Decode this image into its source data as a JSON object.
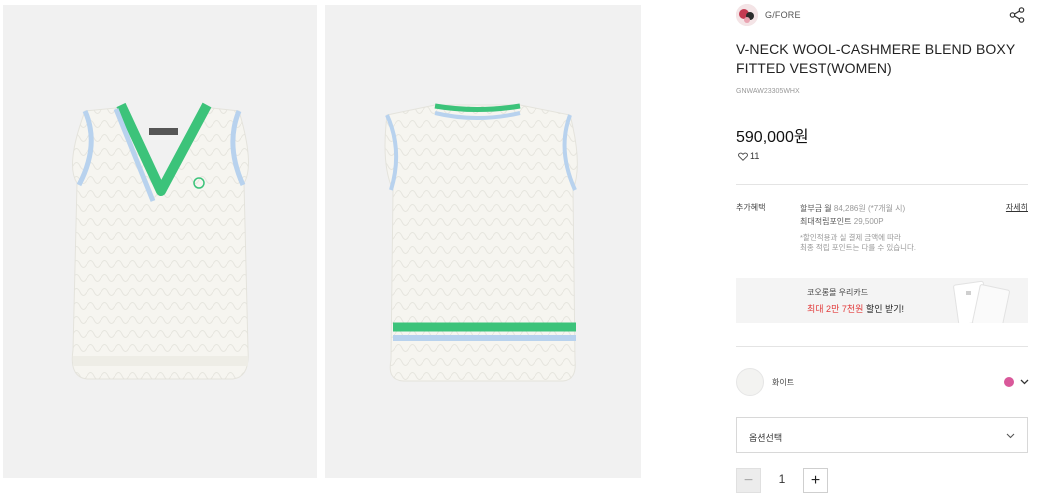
{
  "product": {
    "brand": "G/FORE",
    "title": "V-NECK WOOL-CASHMERE BLEND BOXY FITTED VEST(WOMEN)",
    "code": "GNWAW23305WHX",
    "price": "590,000원",
    "likes": "11"
  },
  "benefits": {
    "label": "추가혜택",
    "installment_prefix": "할부금 월 ",
    "installment_value": "84,286원 (*7개월 시)",
    "points_prefix": "최대적립포인트 ",
    "points_value": "29,500P",
    "note_line1": "*할인적용과 실 결제 금액에 따라",
    "note_line2": "최종 적립 포인트는 다를 수 있습니다.",
    "detail_link": "자세히"
  },
  "banner": {
    "line1": "코오롱몰 우리카드",
    "line2_highlight": "최대 2만 7천원",
    "line2_rest": " 할인 받기!"
  },
  "color_option": {
    "name": "화이트",
    "dot_color": "#d9589a"
  },
  "option_select": {
    "label": "옵션선택"
  },
  "quantity": {
    "minus": "−",
    "value": "1",
    "plus": "+"
  },
  "colors": {
    "trim_green": "#3cc37a",
    "trim_blue": "#b8d2ee",
    "knit_white": "#f6f5f0",
    "sale_red": "#e23b3b"
  },
  "icons": {
    "share": "share-icon",
    "heart": "heart-icon",
    "chevron": "chevron-down-icon"
  }
}
